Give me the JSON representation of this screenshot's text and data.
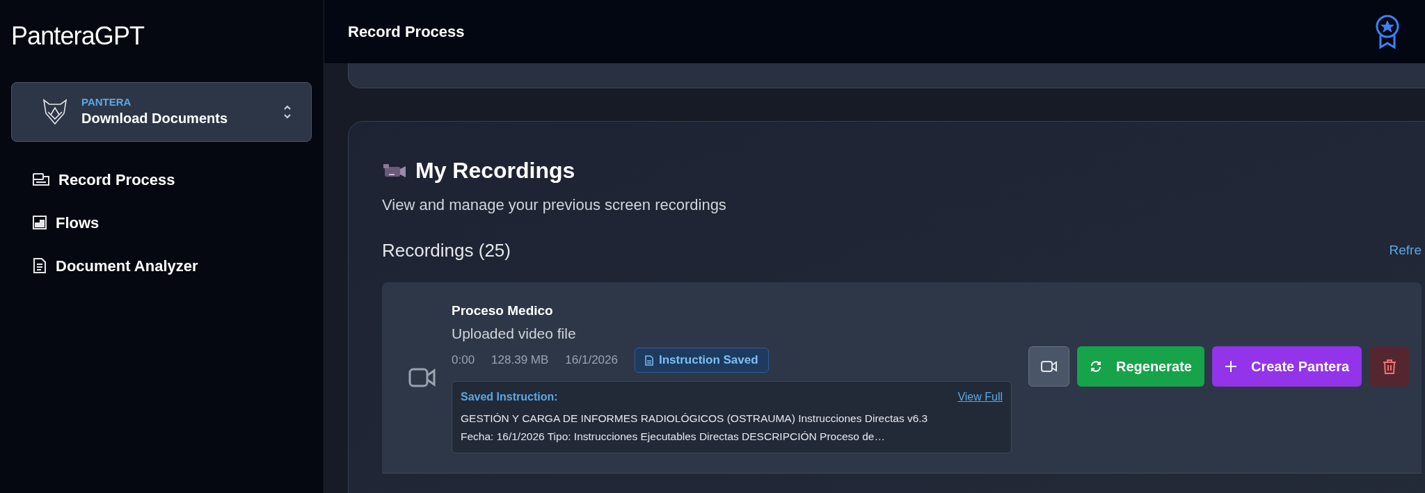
{
  "app": {
    "logo": "PanteraGPT"
  },
  "workspace": {
    "label": "PANTERA",
    "name": "Download Documents"
  },
  "nav": [
    {
      "kind": "record",
      "label": "Record Process"
    },
    {
      "kind": "flows",
      "label": "Flows"
    },
    {
      "kind": "document",
      "label": "Document Analyzer"
    }
  ],
  "header": {
    "title": "Record Process"
  },
  "recordings_panel": {
    "title": "My Recordings",
    "subtitle": "View and manage your previous screen recordings",
    "count_label": "Recordings (25)",
    "refresh_link": "Refre",
    "recordings": [
      {
        "name": "Proceso Medico",
        "source": "Uploaded video file",
        "duration": "0:00",
        "size": "128.39 MB",
        "date": "16/1/2026",
        "badge": "Instruction Saved",
        "saved_instruction": {
          "label": "Saved Instruction:",
          "link": "View Full",
          "lines": [
            "GESTIÓN Y CARGA DE INFORMES RADIOLÓGICOS (OSTRAUMA) Instrucciones Directas v6.3",
            "Fecha: 16/1/2026 Tipo: Instrucciones Ejecutables Directas DESCRIPCIÓN Proceso de…"
          ]
        },
        "actions": [
          {
            "kind": "video"
          },
          {
            "kind": "regenerate",
            "label": "Regenerate"
          },
          {
            "kind": "create",
            "label": "Create Pantera"
          },
          {
            "kind": "delete"
          }
        ]
      }
    ]
  }
}
